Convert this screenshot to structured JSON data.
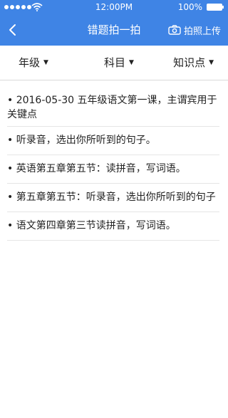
{
  "status_bar": {
    "time": "12:00PM",
    "battery": "100%"
  },
  "header": {
    "title": "错题拍一拍",
    "upload_label": "拍照上传"
  },
  "filters": [
    {
      "label": "年级"
    },
    {
      "label": "科目"
    },
    {
      "label": "知识点"
    }
  ],
  "items": [
    {
      "text": "• 2016-05-30  五年级语文第一课，主谓宾用于关键点"
    },
    {
      "text": "• 听录音，选出你所听到的句子。"
    },
    {
      "text": "• 英语第五章第五节：读拼音，写词语。"
    },
    {
      "text": "• 第五章第五节：听录音，选出你所听到的句子"
    },
    {
      "text": "• 语文第四章第三节读拼音，写词语。"
    }
  ],
  "colors": {
    "header_bg": "#3f84e5"
  }
}
